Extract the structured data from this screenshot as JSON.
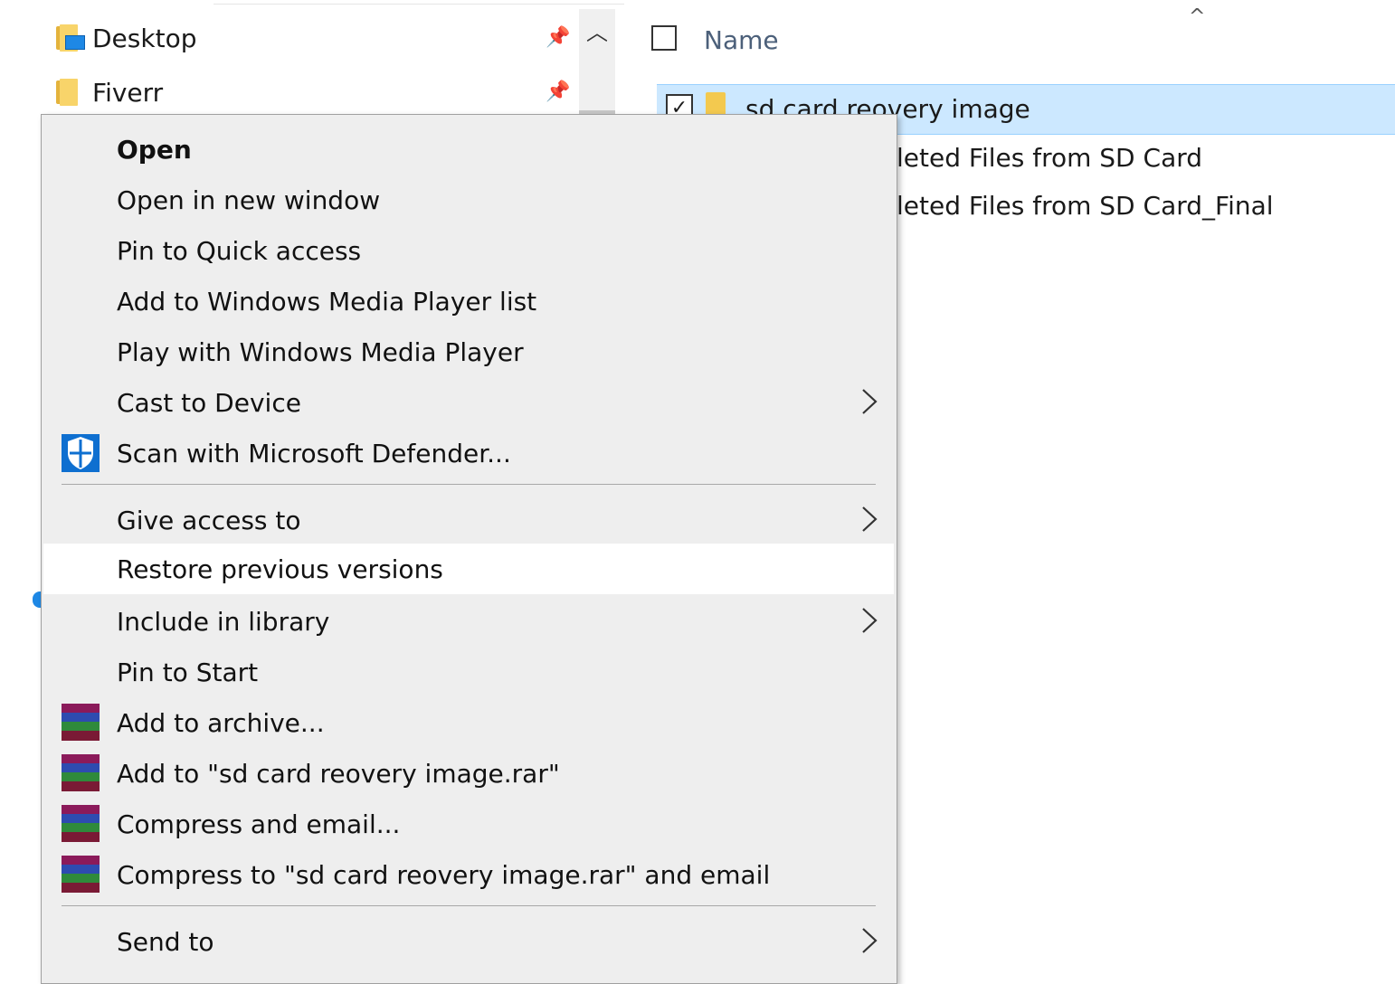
{
  "nav": {
    "items": [
      {
        "label": "Desktop"
      },
      {
        "label": "Fiverr"
      }
    ]
  },
  "file_list": {
    "column_header": "Name",
    "rows": [
      {
        "label": "sd card reovery image",
        "selected": true
      },
      {
        "label": "ver Deleted Files from SD Card",
        "selected": false
      },
      {
        "label": "ver Deleted Files from SD Card_Final",
        "selected": false
      }
    ]
  },
  "context_menu": {
    "items": [
      {
        "label": "Open",
        "bold": true
      },
      {
        "label": "Open in new window"
      },
      {
        "label": "Pin to Quick access"
      },
      {
        "label": "Add to Windows Media Player list"
      },
      {
        "label": "Play with Windows Media Player"
      },
      {
        "label": "Cast to Device",
        "submenu": true
      },
      {
        "label": "Scan with Microsoft Defender...",
        "icon": "defender-shield-icon"
      },
      {
        "label": "Give access to",
        "submenu": true
      },
      {
        "label": "Restore previous versions",
        "hovered": true
      },
      {
        "label": "Include in library",
        "submenu": true
      },
      {
        "label": "Pin to Start"
      },
      {
        "label": "Add to archive...",
        "icon": "winrar-icon"
      },
      {
        "label": "Add to \"sd card reovery image.rar\"",
        "icon": "winrar-icon"
      },
      {
        "label": "Compress and email...",
        "icon": "winrar-icon"
      },
      {
        "label": "Compress to \"sd card reovery image.rar\" and email",
        "icon": "winrar-icon"
      },
      {
        "label": "Send to",
        "submenu": true
      }
    ]
  },
  "colors": {
    "selection_background": "#cce8ff",
    "menu_background": "#eeeeee",
    "defender_blue": "#0e6fd0"
  }
}
